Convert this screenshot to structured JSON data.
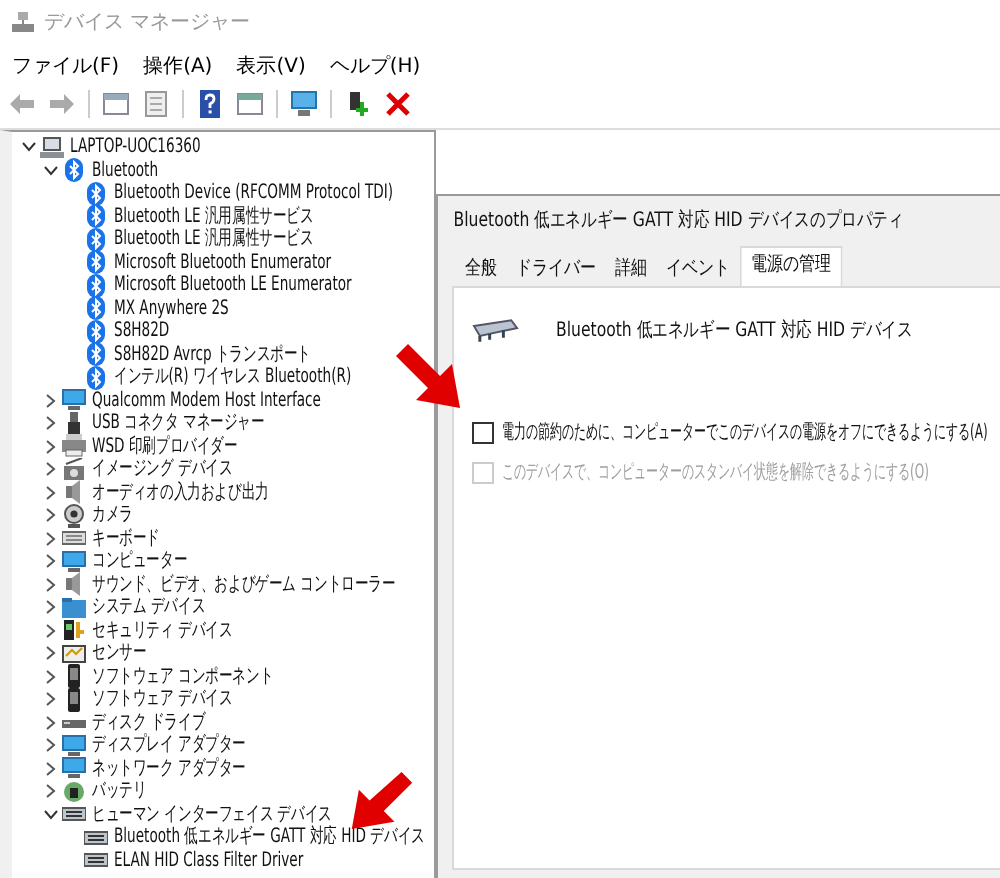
{
  "window": {
    "title": "デバイス マネージャー"
  },
  "menu": [
    "ファイル(F)",
    "操作(A)",
    "表示(V)",
    "ヘルプ(H)"
  ],
  "tree": {
    "label": "LAPTOP-UOC16360",
    "kind": "computer",
    "expanded": true,
    "children": [
      {
        "label": "Bluetooth",
        "kind": "bluetooth",
        "expanded": true,
        "children": [
          {
            "label": "Bluetooth Device (RFCOMM Protocol TDI)",
            "kind": "bluetooth"
          },
          {
            "label": "Bluetooth LE 汎用属性サービス",
            "kind": "bluetooth"
          },
          {
            "label": "Bluetooth LE 汎用属性サービス",
            "kind": "bluetooth"
          },
          {
            "label": "Microsoft Bluetooth Enumerator",
            "kind": "bluetooth"
          },
          {
            "label": "Microsoft Bluetooth LE Enumerator",
            "kind": "bluetooth"
          },
          {
            "label": "MX Anywhere 2S",
            "kind": "bluetooth"
          },
          {
            "label": "S8H82D",
            "kind": "bluetooth"
          },
          {
            "label": "S8H82D Avrcp トランスポート",
            "kind": "bluetooth"
          },
          {
            "label": "インテル(R) ワイヤレス Bluetooth(R)",
            "kind": "bluetooth"
          }
        ]
      },
      {
        "label": "Qualcomm Modem Host Interface",
        "kind": "monitor",
        "expanded": false
      },
      {
        "label": "USB コネクタ マネージャー",
        "kind": "usb",
        "expanded": false
      },
      {
        "label": "WSD 印刷プロバイダー",
        "kind": "printer",
        "expanded": false
      },
      {
        "label": "イメージング デバイス",
        "kind": "camera",
        "expanded": false
      },
      {
        "label": "オーディオの入力および出力",
        "kind": "speaker",
        "expanded": false
      },
      {
        "label": "カメラ",
        "kind": "webcam",
        "expanded": false
      },
      {
        "label": "キーボード",
        "kind": "keyboard",
        "expanded": false
      },
      {
        "label": "コンピューター",
        "kind": "monitor",
        "expanded": false
      },
      {
        "label": "サウンド、ビデオ、およびゲーム コントローラー",
        "kind": "speaker",
        "expanded": false
      },
      {
        "label": "システム デバイス",
        "kind": "folder",
        "expanded": false
      },
      {
        "label": "セキュリティ デバイス",
        "kind": "key",
        "expanded": false
      },
      {
        "label": "センサー",
        "kind": "sensor",
        "expanded": false
      },
      {
        "label": "ソフトウェア コンポーネント",
        "kind": "phone",
        "expanded": false
      },
      {
        "label": "ソフトウェア デバイス",
        "kind": "phone",
        "expanded": false
      },
      {
        "label": "ディスク ドライブ",
        "kind": "disk",
        "expanded": false
      },
      {
        "label": "ディスプレイ アダプター",
        "kind": "monitor",
        "expanded": false
      },
      {
        "label": "ネットワーク アダプター",
        "kind": "monitor",
        "expanded": false
      },
      {
        "label": "バッテリ",
        "kind": "battery",
        "expanded": false
      },
      {
        "label": "ヒューマン インターフェイス デバイス",
        "kind": "hid",
        "expanded": true,
        "children": [
          {
            "label": "Bluetooth 低エネルギー GATT 対応 HID デバイス",
            "kind": "hid"
          },
          {
            "label": "ELAN HID Class Filter Driver",
            "kind": "hid"
          }
        ]
      }
    ]
  },
  "dialog": {
    "title": "Bluetooth 低エネルギー GATT 対応 HID デバイスのプロパティ",
    "tabs": [
      {
        "label": "全般",
        "selected": false
      },
      {
        "label": "ドライバー",
        "selected": false
      },
      {
        "label": "詳細",
        "selected": false
      },
      {
        "label": "イベント",
        "selected": false
      },
      {
        "label": "電源の管理",
        "selected": true
      }
    ],
    "device_name": "Bluetooth 低エネルギー GATT 対応 HID デバイス",
    "options": [
      {
        "label": "電力の節約のために、コンピューターでこのデバイスの電源をオフにできるようにする(A)",
        "checked": false,
        "disabled": false
      },
      {
        "label": "このデバイスで、コンピューターのスタンバイ状態を解除できるようにする(O)",
        "checked": false,
        "disabled": true
      }
    ]
  }
}
